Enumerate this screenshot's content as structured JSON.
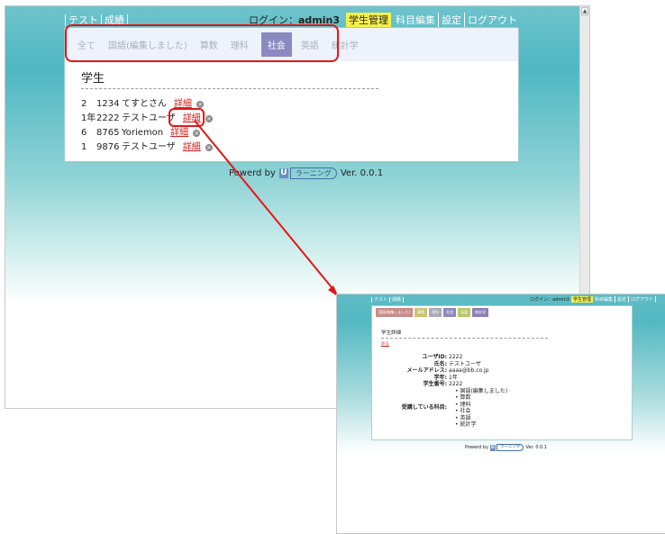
{
  "main": {
    "topnav": [
      "テスト",
      "成績"
    ],
    "login_label": "ログイン：",
    "login_user": "admin3",
    "usernav": {
      "student_mgmt": "学生管理",
      "subject_edit": "科目編集",
      "settings": "設定",
      "logout": "ログアウト"
    },
    "tabs": [
      {
        "label": "全て",
        "active": false
      },
      {
        "label": "国語(編集しました)",
        "active": false
      },
      {
        "label": "算数",
        "active": false
      },
      {
        "label": "理科",
        "active": false
      },
      {
        "label": "社会",
        "active": true
      },
      {
        "label": "英語",
        "active": false
      },
      {
        "label": "統計学",
        "active": false
      }
    ],
    "section_title": "学生",
    "detail_label": "詳細",
    "rows": [
      {
        "grade": "2",
        "number": "1234",
        "name": "てすとさん"
      },
      {
        "grade": "1年",
        "number": "2222",
        "name": "テストユーザ"
      },
      {
        "grade": "6",
        "number": "8765",
        "name": "Yoriemon"
      },
      {
        "grade": "1",
        "number": "9876",
        "name": "テストユーザ"
      }
    ],
    "footer_prefix": "Powerd by",
    "footer_logo": "U",
    "footer_brand": "ラーニング",
    "footer_version": "Ver. 0.0.1",
    "scroll_up_glyph": "▲"
  },
  "detail_window": {
    "topnav": [
      "テスト",
      "成績"
    ],
    "login": "ログイン：admin3",
    "usernav": [
      "学生管理",
      "科目編集",
      "設定",
      "ログアウト"
    ],
    "tabs": [
      {
        "label": "国語(編集しました)",
        "color": "#c98a8a"
      },
      {
        "label": "算数",
        "color": "#c9c472"
      },
      {
        "label": "理科",
        "color": "#a9a9b9"
      },
      {
        "label": "社会",
        "color": "#8b89bf"
      },
      {
        "label": "英語",
        "color": "#b8c86a"
      },
      {
        "label": "統計学",
        "color": "#8d7fb5"
      }
    ],
    "title": "学生詳細",
    "back": "戻る",
    "fields": [
      {
        "label": "ユーザID:",
        "value": "2222"
      },
      {
        "label": "氏名:",
        "value": "テストユーザ"
      },
      {
        "label": "メールアドレス:",
        "value": "aaaa@bb.co.jp"
      },
      {
        "label": "学年:",
        "value": "1年"
      },
      {
        "label": "学生番号:",
        "value": "2222"
      }
    ],
    "subjects_label": "受講している科目:",
    "subjects": [
      "国語(編集しました)",
      "算数",
      "理科",
      "社会",
      "英語",
      "統計学"
    ],
    "footer_prefix": "Powerd by",
    "footer_logo": "U",
    "footer_brand": "ラーニング",
    "footer_version": "Ver. 0.0.1"
  },
  "colors": {
    "highlight": "#e21717",
    "active_tab": "#8b89bf",
    "accent_yellow": "#f6f04a"
  }
}
